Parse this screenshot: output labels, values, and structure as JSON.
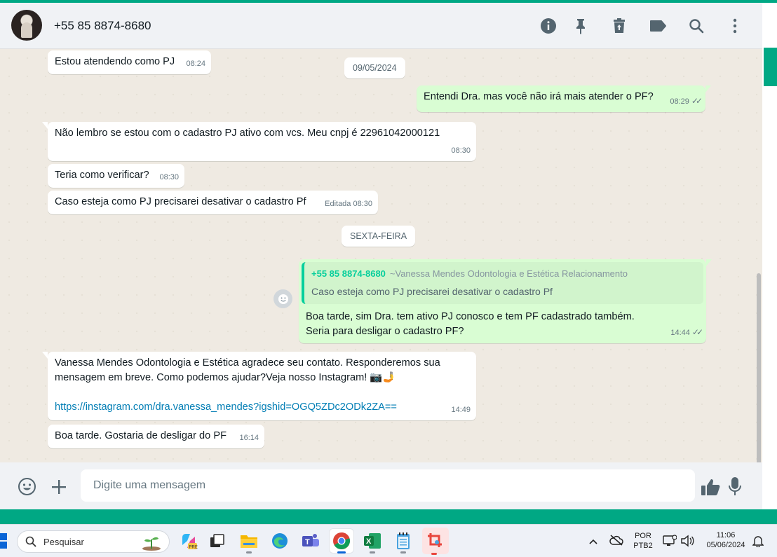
{
  "header": {
    "contact_name": "+55 85 8874-8680",
    "icons": [
      "info-icon",
      "pin-icon",
      "delete-icon",
      "label-icon",
      "search-icon",
      "menu-icon"
    ]
  },
  "messages": [
    {
      "dir": "in",
      "text": "Estou atendendo como PJ",
      "time": "08:24"
    },
    {
      "type": "date",
      "text": "09/05/2024"
    },
    {
      "dir": "out",
      "text": "Entendi Dra. mas você não irá mais atender o PF?",
      "time": "08:29",
      "status": "read"
    },
    {
      "dir": "in",
      "text": "Não lembro se estou com o cadastro PJ ativo com vcs. Meu cnpj é 22961042000121",
      "time": "08:30"
    },
    {
      "dir": "in",
      "text": "Teria como verificar?",
      "time": "08:30"
    },
    {
      "dir": "in",
      "text": "Caso esteja como PJ precisarei desativar o cadastro Pf",
      "time": "Editada 08:30"
    },
    {
      "type": "date",
      "text": "SEXTA-FEIRA"
    },
    {
      "dir": "out",
      "quote": {
        "name": "+55 85 8874-8680",
        "sub": "~Vanessa Mendes Odontologia e Estética Relacionamento",
        "text": "Caso esteja como PJ precisarei desativar o cadastro Pf"
      },
      "line1": "Boa tarde, sim Dra. tem ativo PJ conosco e tem PF cadastrado também.",
      "line2": "Seria para desligar o cadastro PF?",
      "time": "14:44",
      "status": "read"
    },
    {
      "dir": "in",
      "line1": "Vanessa Mendes Odontologia e Estética agradece seu contato. Responderemos sua",
      "line2": "mensagem em breve. Como podemos ajudar?Veja nosso Instagram! 📷🤳",
      "link": "https://instagram.com/dra.vanessa_mendes?igshid=OGQ5ZDc2ODk2ZA==",
      "time": "14:49"
    },
    {
      "dir": "in",
      "text": "Boa tarde. Gostaria de desligar do PF",
      "time": "16:14"
    }
  ],
  "composer": {
    "placeholder": "Digite uma mensagem"
  },
  "taskbar": {
    "search_label": "Pesquisar",
    "lang_top": "POR",
    "lang_bottom": "PTB2",
    "clock_time": "11:06",
    "clock_date": "05/06/2024"
  },
  "colors": {
    "accent": "#00a884",
    "outgoing_bubble": "#d9fdd3",
    "chat_bg": "#efeae2"
  }
}
